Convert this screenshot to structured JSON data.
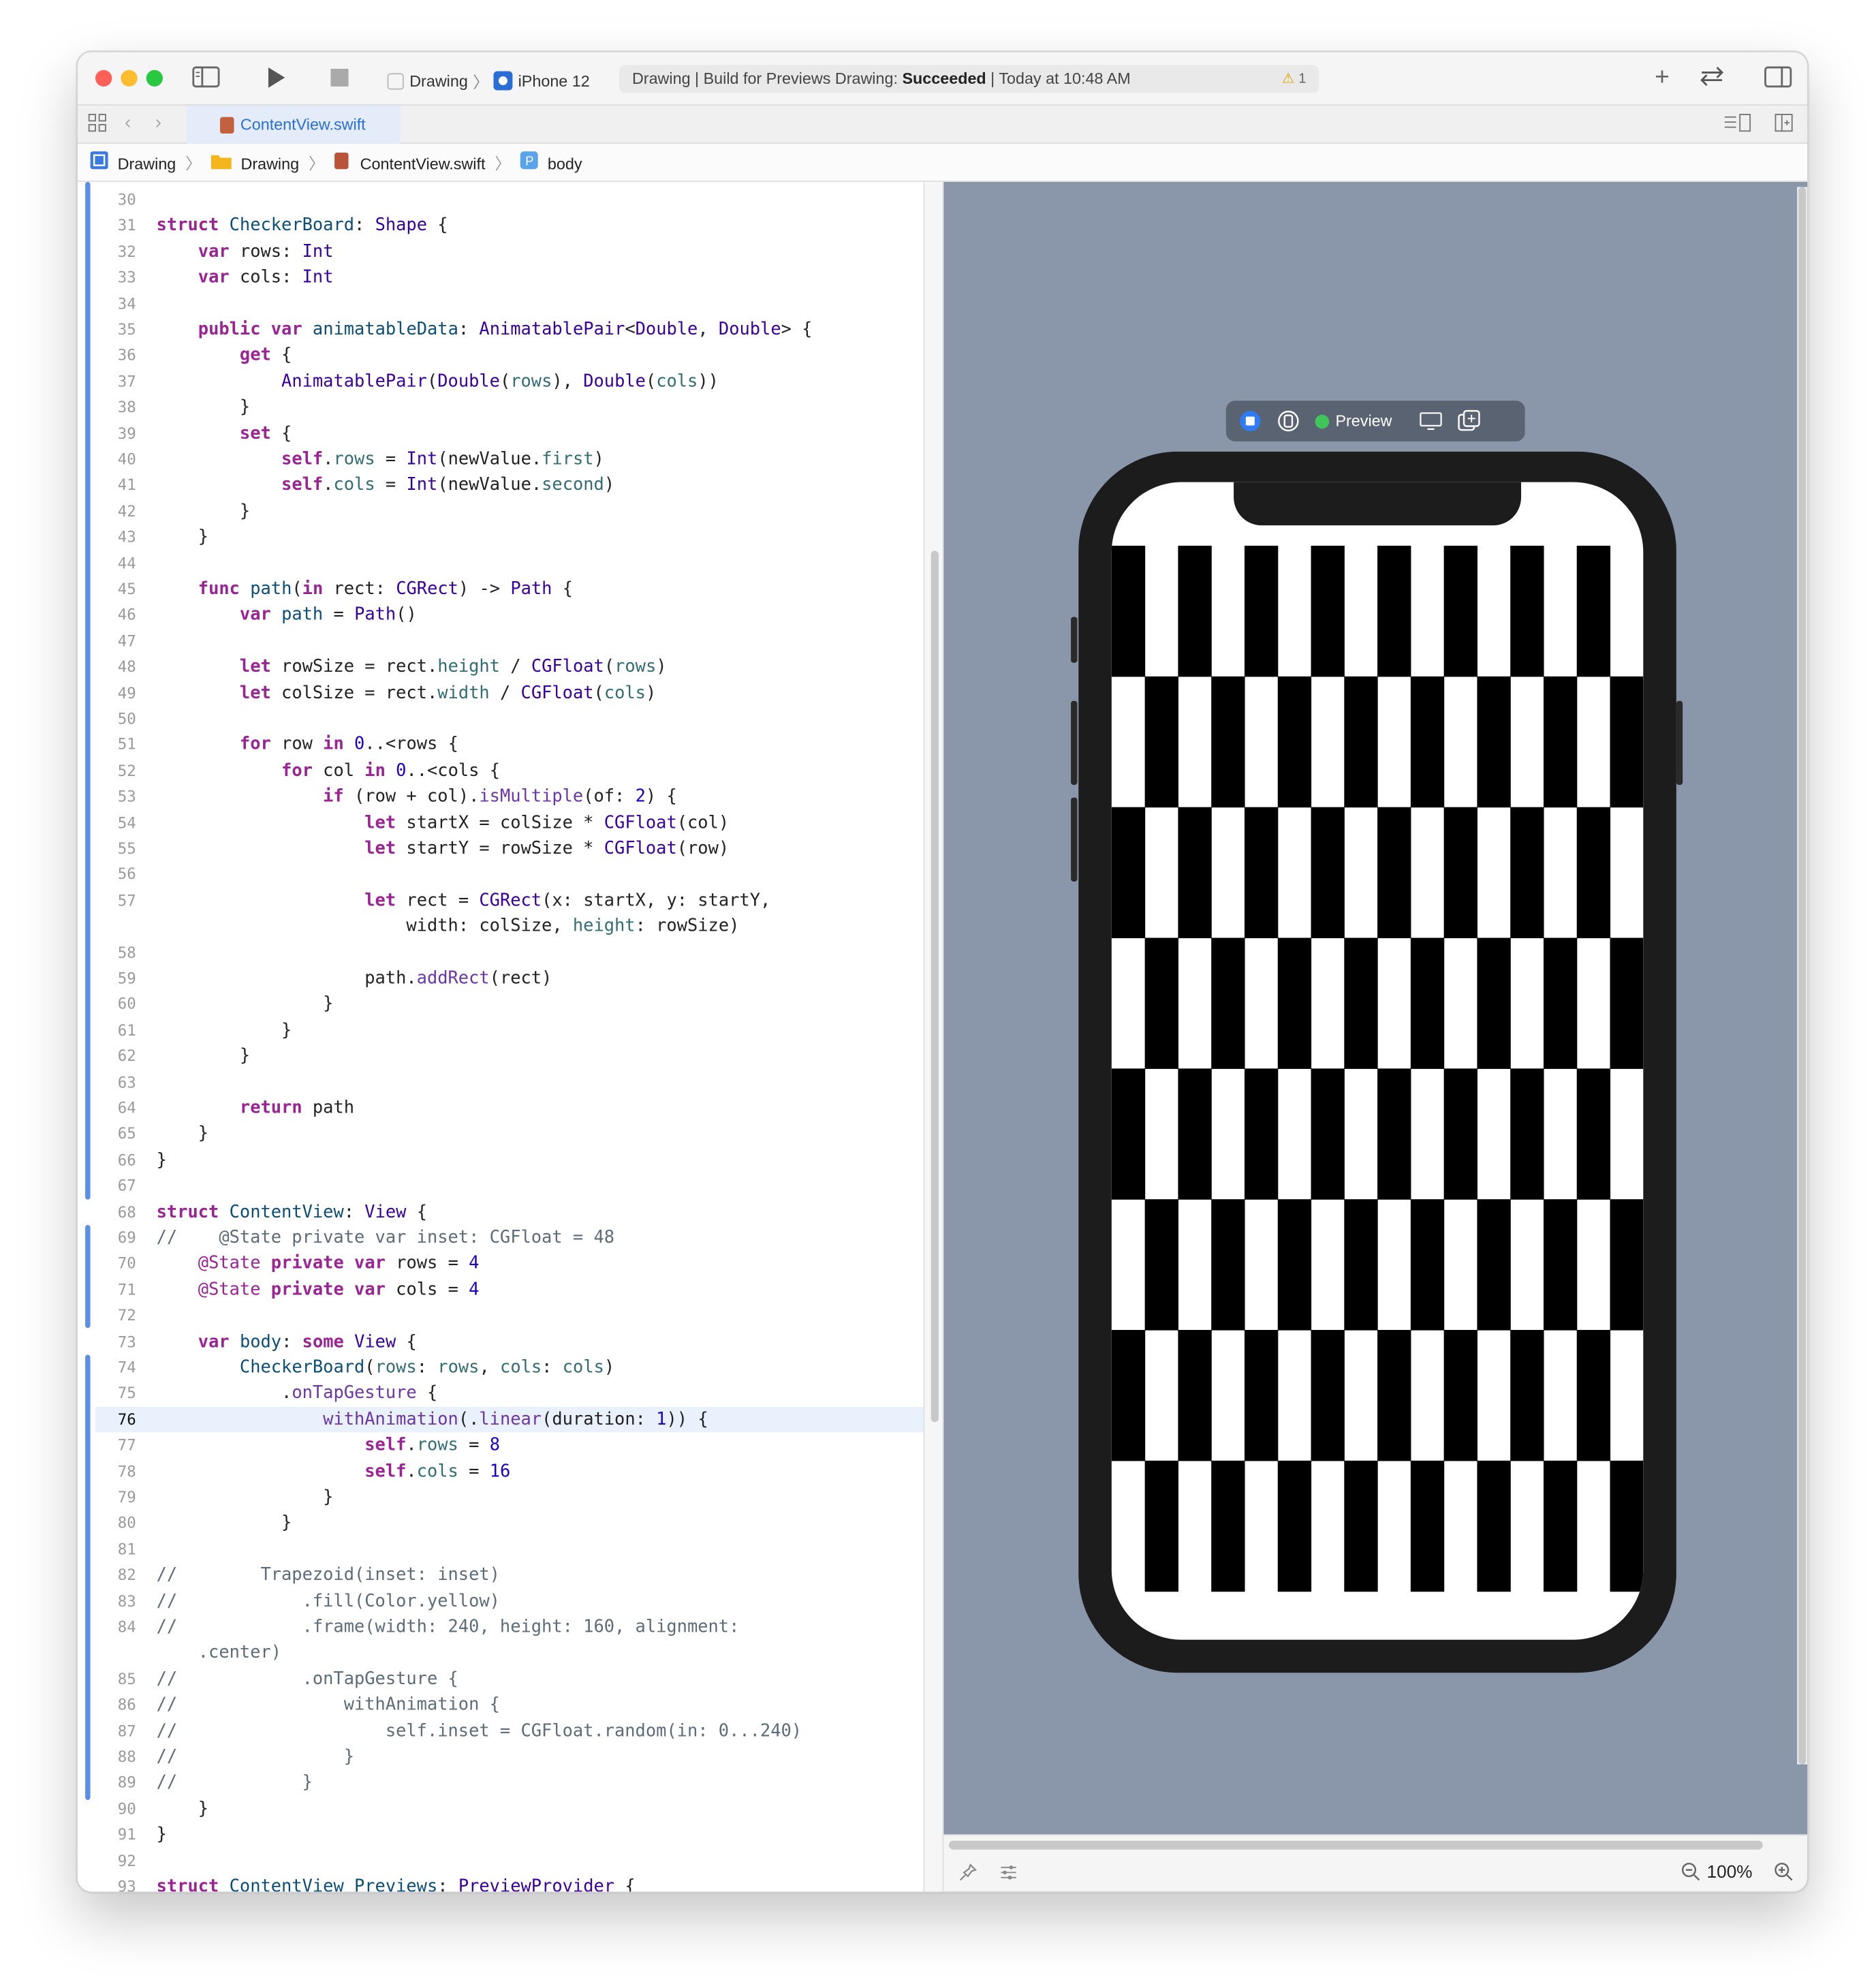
{
  "window": {
    "scheme": "Drawing",
    "device": "iPhone 12",
    "status_prefix": "Drawing | Build for Previews Drawing: ",
    "status_result": "Succeeded",
    "status_time": " | Today at 10:48 AM",
    "warning_count": "1"
  },
  "tab": {
    "label": "ContentView.swift"
  },
  "breadcrumb": [
    "Drawing",
    "Drawing",
    "ContentView.swift",
    "body"
  ],
  "editor": {
    "current_line": "76",
    "lines": [
      {
        "n": "30",
        "t": ""
      },
      {
        "n": "31",
        "t": "struct CheckerBoard: Shape {"
      },
      {
        "n": "32",
        "t": "    var rows: Int"
      },
      {
        "n": "33",
        "t": "    var cols: Int"
      },
      {
        "n": "34",
        "t": ""
      },
      {
        "n": "35",
        "t": "    public var animatableData: AnimatablePair<Double, Double> {"
      },
      {
        "n": "36",
        "t": "        get {"
      },
      {
        "n": "37",
        "t": "            AnimatablePair(Double(rows), Double(cols))"
      },
      {
        "n": "38",
        "t": "        }"
      },
      {
        "n": "39",
        "t": "        set {"
      },
      {
        "n": "40",
        "t": "            self.rows = Int(newValue.first)"
      },
      {
        "n": "41",
        "t": "            self.cols = Int(newValue.second)"
      },
      {
        "n": "42",
        "t": "        }"
      },
      {
        "n": "43",
        "t": "    }"
      },
      {
        "n": "44",
        "t": ""
      },
      {
        "n": "45",
        "t": "    func path(in rect: CGRect) -> Path {"
      },
      {
        "n": "46",
        "t": "        var path = Path()"
      },
      {
        "n": "47",
        "t": ""
      },
      {
        "n": "48",
        "t": "        let rowSize = rect.height / CGFloat(rows)"
      },
      {
        "n": "49",
        "t": "        let colSize = rect.width / CGFloat(cols)"
      },
      {
        "n": "50",
        "t": ""
      },
      {
        "n": "51",
        "t": "        for row in 0..<rows {"
      },
      {
        "n": "52",
        "t": "            for col in 0..<cols {"
      },
      {
        "n": "53",
        "t": "                if (row + col).isMultiple(of: 2) {"
      },
      {
        "n": "54",
        "t": "                    let startX = colSize * CGFloat(col)"
      },
      {
        "n": "55",
        "t": "                    let startY = rowSize * CGFloat(row)"
      },
      {
        "n": "56",
        "t": ""
      },
      {
        "n": "57",
        "t": "                    let rect = CGRect(x: startX, y: startY,"
      },
      {
        "n": "",
        "t": "                        width: colSize, height: rowSize)"
      },
      {
        "n": "58",
        "t": ""
      },
      {
        "n": "59",
        "t": "                    path.addRect(rect)"
      },
      {
        "n": "60",
        "t": "                }"
      },
      {
        "n": "61",
        "t": "            }"
      },
      {
        "n": "62",
        "t": "        }"
      },
      {
        "n": "63",
        "t": ""
      },
      {
        "n": "64",
        "t": "        return path"
      },
      {
        "n": "65",
        "t": "    }"
      },
      {
        "n": "66",
        "t": "}"
      },
      {
        "n": "67",
        "t": ""
      },
      {
        "n": "68",
        "t": "struct ContentView: View {"
      },
      {
        "n": "69",
        "t": "//    @State private var inset: CGFloat = 48"
      },
      {
        "n": "70",
        "t": "    @State private var rows = 4"
      },
      {
        "n": "71",
        "t": "    @State private var cols = 4"
      },
      {
        "n": "72",
        "t": ""
      },
      {
        "n": "73",
        "t": "    var body: some View {"
      },
      {
        "n": "74",
        "t": "        CheckerBoard(rows: rows, cols: cols)"
      },
      {
        "n": "75",
        "t": "            .onTapGesture {"
      },
      {
        "n": "76",
        "t": "                withAnimation(.linear(duration: 1)) {"
      },
      {
        "n": "77",
        "t": "                    self.rows = 8"
      },
      {
        "n": "78",
        "t": "                    self.cols = 16"
      },
      {
        "n": "79",
        "t": "                }"
      },
      {
        "n": "80",
        "t": "            }"
      },
      {
        "n": "81",
        "t": ""
      },
      {
        "n": "82",
        "t": "//        Trapezoid(inset: inset)"
      },
      {
        "n": "83",
        "t": "//            .fill(Color.yellow)"
      },
      {
        "n": "84",
        "t": "//            .frame(width: 240, height: 160, alignment:"
      },
      {
        "n": "",
        "t": "    .center)"
      },
      {
        "n": "85",
        "t": "//            .onTapGesture {"
      },
      {
        "n": "86",
        "t": "//                withAnimation {"
      },
      {
        "n": "87",
        "t": "//                    self.inset = CGFloat.random(in: 0...240)"
      },
      {
        "n": "88",
        "t": "//                }"
      },
      {
        "n": "89",
        "t": "//            }"
      },
      {
        "n": "90",
        "t": "    }"
      },
      {
        "n": "91",
        "t": "}"
      },
      {
        "n": "92",
        "t": ""
      },
      {
        "n": "93",
        "t": "struct ContentView_Previews: PreviewProvider {"
      }
    ]
  },
  "preview": {
    "label": "Preview",
    "zoom": "100%",
    "board": {
      "rows": 8,
      "cols": 16
    }
  },
  "colors": {
    "keyword": "#9b2393",
    "type": "#3900a0",
    "property": "#326d74",
    "method": "#6c36a9",
    "number": "#1c00cf",
    "comment": "#5d6c79",
    "accent": "#2a6fd8"
  }
}
